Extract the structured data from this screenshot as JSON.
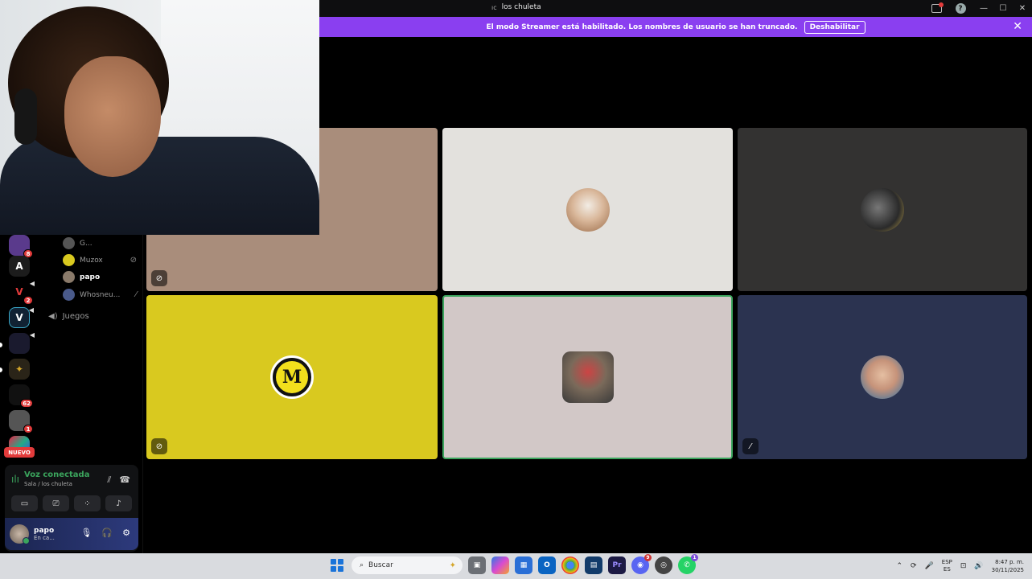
{
  "window": {
    "title": "los chuleta"
  },
  "banner": {
    "message": "El modo Streamer está habilitado. Los nombres de usuario se han truncado.",
    "button_label": "Deshabilitar",
    "close_glyph": "✕"
  },
  "servers": {
    "badges": [
      "8",
      "2",
      "62",
      "1"
    ],
    "text_server_letter": "A",
    "nuevo_label": "NUEVO"
  },
  "channel": {
    "members": [
      {
        "name": "G...",
        "active": false,
        "status_icon": ""
      },
      {
        "name": "Muzox",
        "active": false,
        "status_icon": "deafened-icon"
      },
      {
        "name": "papo",
        "active": true,
        "status_icon": ""
      },
      {
        "name": "Whosneu...",
        "active": false,
        "status_icon": "muted-icon"
      }
    ],
    "voice_channel_name": "Juegos"
  },
  "voice_panel": {
    "status": "Voz conectada",
    "location": "Sala / los chuleta"
  },
  "user_panel": {
    "username": "papo",
    "status": "En ca..."
  },
  "taskbar": {
    "search_placeholder": "Buscar",
    "lang_line1": "ESP",
    "lang_line2": "ES",
    "time": "8:47 p. m.",
    "date": "30/11/2025",
    "discord_badge": "9",
    "whatsapp_badge": "1"
  },
  "colors": {
    "streamer_banner": "#8a3ff0",
    "voice_connected": "#3ba55d",
    "notification_badge": "#e23b3b",
    "speaking_border": "#3ba55d"
  }
}
